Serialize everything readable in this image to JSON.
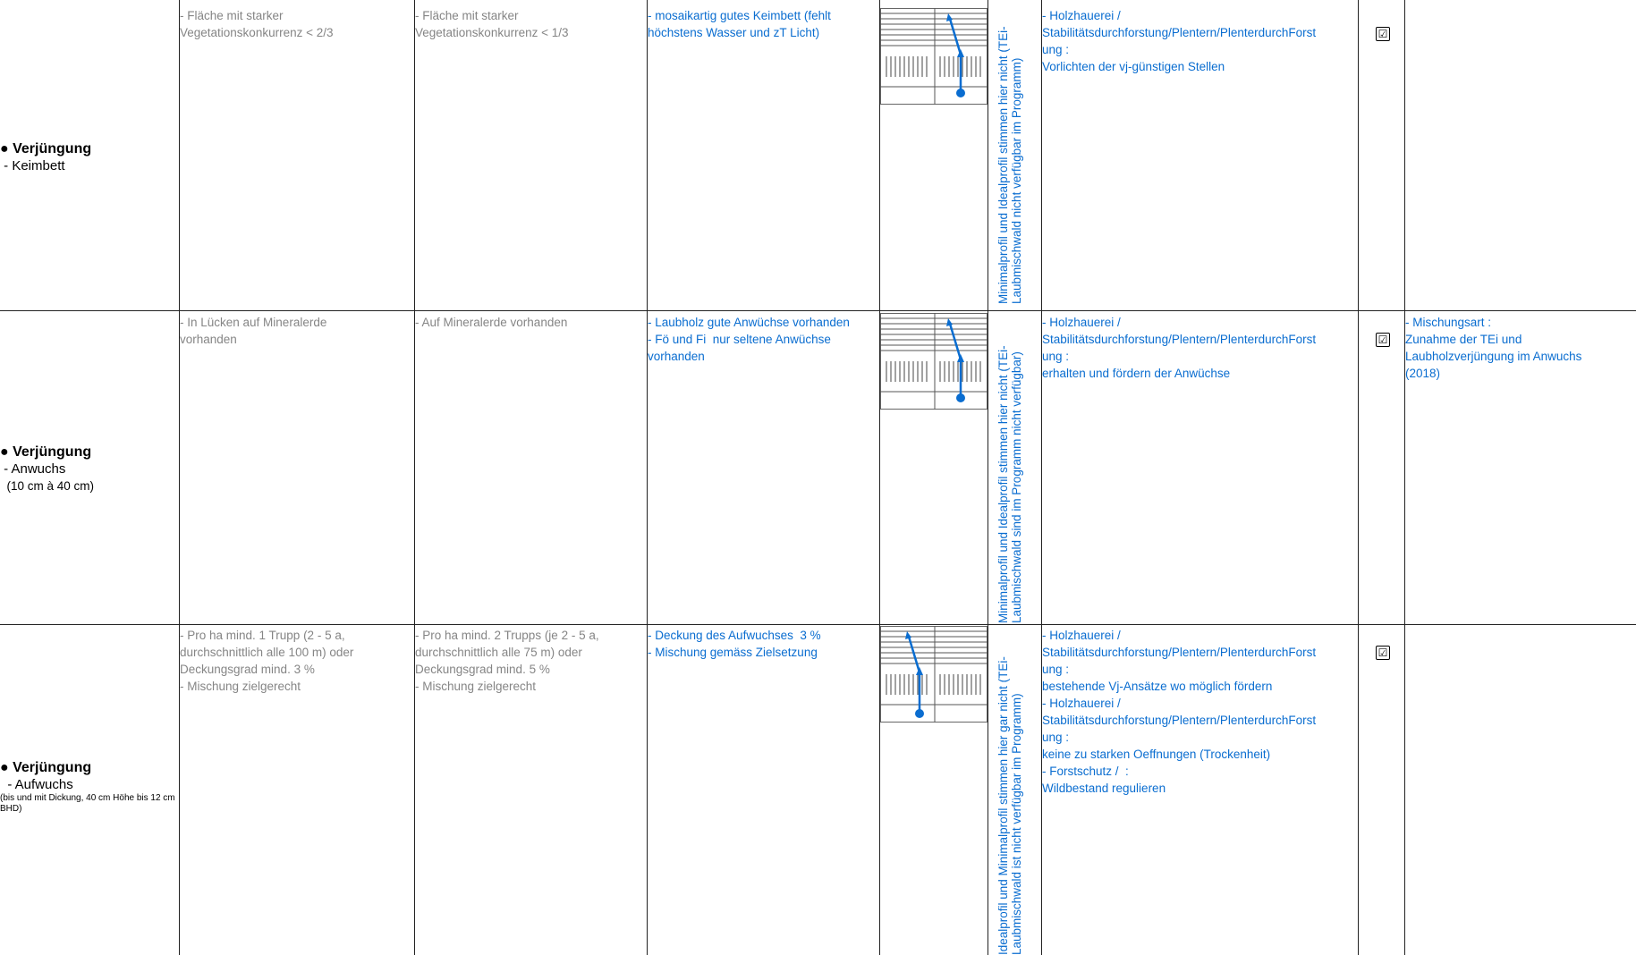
{
  "rows": [
    {
      "label": {
        "title": "● Verjüngung",
        "sub": " - Keimbett",
        "sub2": "",
        "small": ""
      },
      "col_minimal": [
        "- Fläche mit starker",
        "Vegetationskonkurrenz < 2/3"
      ],
      "col_ideal": [
        "- Fläche mit starker",
        "Vegetationskonkurrenz < 1/3"
      ],
      "col_zustand": [
        "- mosaikartig gutes Keimbett (fehlt",
        "höchstens Wasser und zT Licht)"
      ],
      "rotated": [
        "Minimalprofil und Idealprofil stimmen hier nicht (TEi-",
        "Laubmischwald nicht verfügbar im Programm)"
      ],
      "massnahmen": [
        "- Holzhauerei /",
        "Stabilitätsdurchforstung/Plentern/PlenterdurchForst",
        "ung :",
        "Vorlichten der vj-günstigen Stellen"
      ],
      "checkbox": "☑",
      "bemerkung": []
    },
    {
      "label": {
        "title": "● Verjüngung",
        "sub": " - Anwuchs",
        "sub2": "  (10 cm à 40 cm)",
        "small": ""
      },
      "col_minimal": [
        "- In Lücken auf Mineralerde",
        "vorhanden"
      ],
      "col_ideal": [
        "- Auf Mineralerde vorhanden"
      ],
      "col_zustand": [
        "- Laubholz gute Anwüchse vorhanden",
        "- Fö und Fi  nur seltene Anwüchse",
        "vorhanden"
      ],
      "rotated": [
        "Minimalprofil und Idealprofil stimmen hier nicht (TEi-",
        "Laubmischwald sind im Programm nicht verfügbar)"
      ],
      "massnahmen": [
        "- Holzhauerei /",
        "Stabilitätsdurchforstung/Plentern/PlenterdurchForst",
        "ung :",
        "erhalten und fördern der Anwüchse"
      ],
      "checkbox": "☑",
      "bemerkung": [
        "- Mischungsart :",
        "Zunahme der TEi und",
        "Laubholzverjüngung im Anwuchs",
        "(2018)"
      ]
    },
    {
      "label": {
        "title": "● Verjüngung",
        "sub": "  - Aufwuchs",
        "sub2": "",
        "small": "(bis und mit Dickung, 40 cm Höhe bis 12 cm BHD)"
      },
      "col_minimal": [
        "- Pro ha mind. 1 Trupp (2 - 5 a,",
        "durchschnittlich alle 100 m) oder",
        "Deckungsgrad mind. 3 %",
        "- Mischung zielgerecht"
      ],
      "col_ideal": [
        "- Pro ha mind. 2 Trupps (je 2 - 5 a,",
        "durchschnittlich alle 75 m) oder",
        "Deckungsgrad mind. 5 %",
        "- Mischung zielgerecht"
      ],
      "col_zustand": [
        "- Deckung des Aufwuchses  3 %",
        "- Mischung gemäss Zielsetzung"
      ],
      "rotated": [
        "Idealprofil und Minimalprofil stimmen hier gar nicht (TEi-",
        "Laubmischwald ist nicht verfügbar im Programm)"
      ],
      "massnahmen": [
        "- Holzhauerei /",
        "Stabilitätsdurchforstung/Plentern/PlenterdurchForst",
        "ung :",
        "bestehende Vj-Ansätze wo möglich fördern",
        "- Holzhauerei /",
        "Stabilitätsdurchforstung/Plentern/PlenterdurchForst",
        "ung :",
        "keine zu starken Oeffnungen (Trockenheit)",
        "- Forstschutz /  :",
        "Wildbestand regulieren"
      ],
      "checkbox": "☑",
      "bemerkung": []
    }
  ],
  "colors": {
    "text_blue": "#0a6dd0",
    "text_grey": "#858585",
    "marker_blue": "#0a6dd0"
  }
}
